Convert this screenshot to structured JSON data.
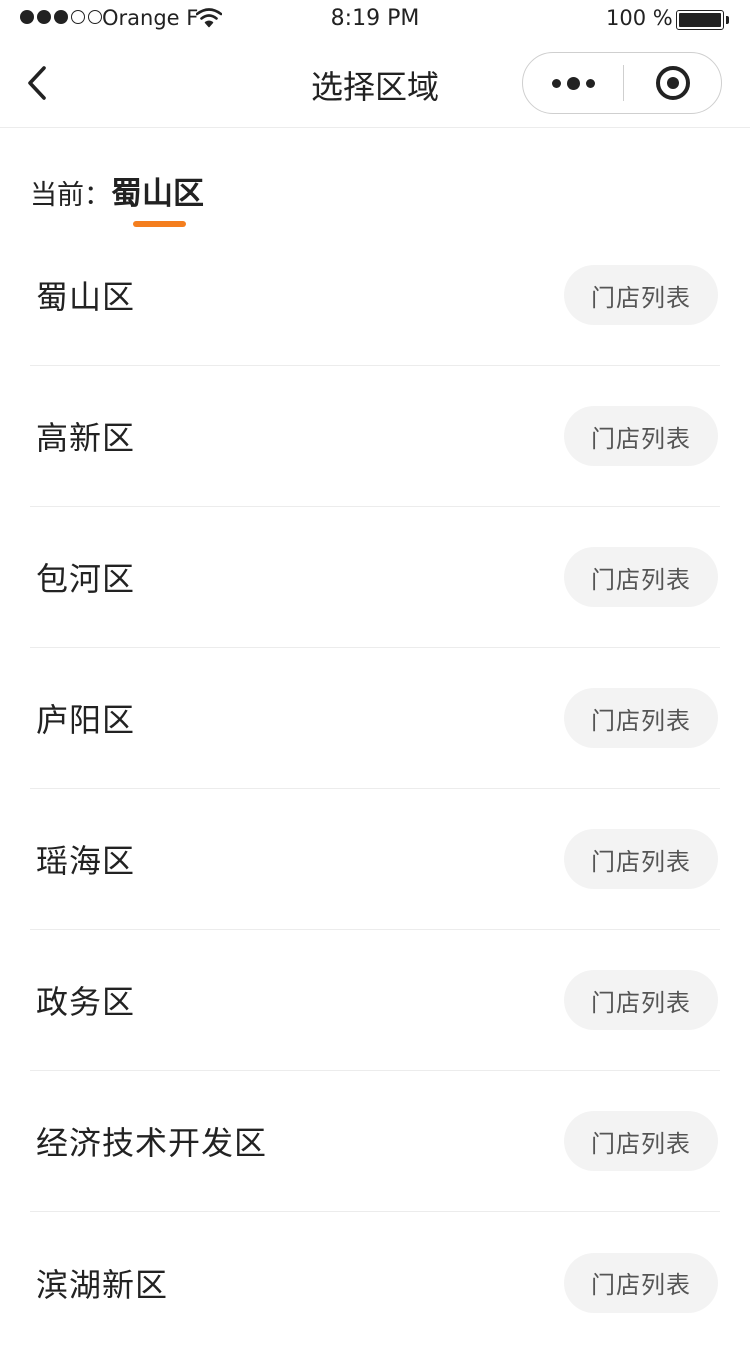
{
  "status_bar": {
    "carrier": "Orange F",
    "time": "8:19 PM",
    "battery": "100 %",
    "battery_level": 1.0,
    "signal_filled": 3,
    "signal_total": 5
  },
  "nav": {
    "title": "选择区域",
    "back_icon": "chevron-left-icon",
    "more_icon": "more-dots-icon",
    "close_icon": "target-circle-icon"
  },
  "current": {
    "label": "当前：",
    "value": "蜀山区"
  },
  "districts": [
    {
      "name": "蜀山区",
      "button": "门店列表"
    },
    {
      "name": "高新区",
      "button": "门店列表"
    },
    {
      "name": "包河区",
      "button": "门店列表"
    },
    {
      "name": "庐阳区",
      "button": "门店列表"
    },
    {
      "name": "瑶海区",
      "button": "门店列表"
    },
    {
      "name": "政务区",
      "button": "门店列表"
    },
    {
      "name": "经济技术开发区",
      "button": "门店列表"
    },
    {
      "name": "滨湖新区",
      "button": "门店列表"
    }
  ],
  "colors": {
    "accent": "#f47e1e",
    "button_bg": "#f3f3f3",
    "divider": "#ececec"
  }
}
